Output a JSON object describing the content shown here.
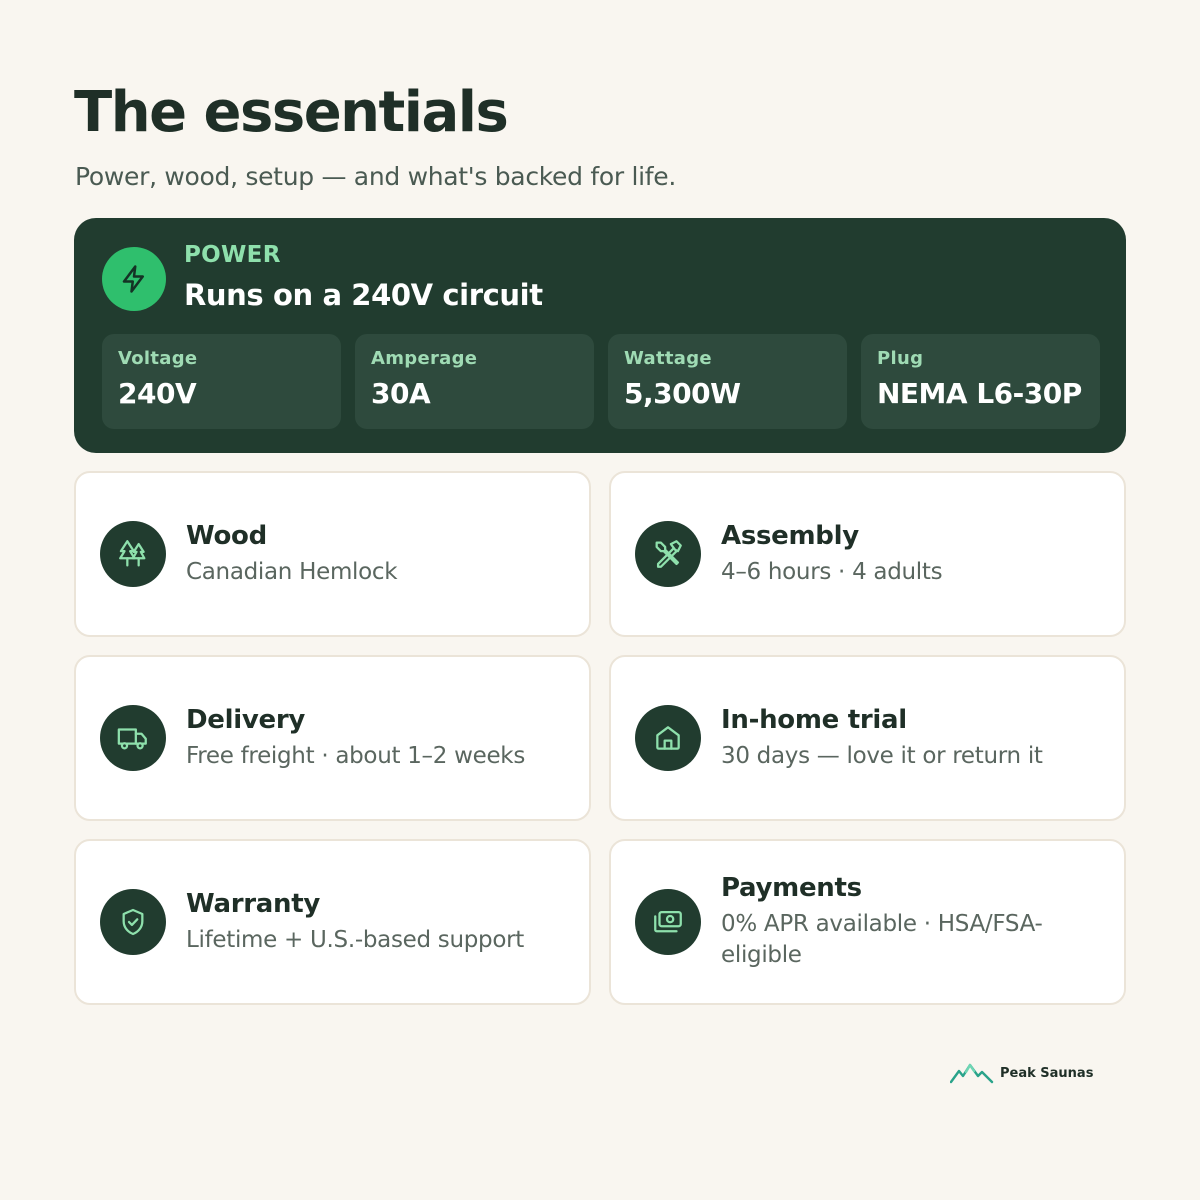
{
  "header": {
    "title": "The essentials",
    "subtitle": "Power, wood, setup — and what's backed for life."
  },
  "power": {
    "eyebrow": "POWER",
    "headline": "Runs on a 240V circuit",
    "icon": "lightning-bolt-icon",
    "specs": [
      {
        "label": "Voltage",
        "value": "240V"
      },
      {
        "label": "Amperage",
        "value": "30A"
      },
      {
        "label": "Wattage",
        "value": "5,300W"
      },
      {
        "label": "Plug",
        "value": "NEMA L6-30P"
      }
    ]
  },
  "features": [
    {
      "title": "Wood",
      "desc": "Canadian Hemlock",
      "icon": "tree-icon"
    },
    {
      "title": "Assembly",
      "desc": "4–6 hours · 4 adults",
      "icon": "tools-icon"
    },
    {
      "title": "Delivery",
      "desc": "Free freight · about 1–2 weeks",
      "icon": "truck-icon"
    },
    {
      "title": "In-home trial",
      "desc": "30 days — love it or return it",
      "icon": "home-icon"
    },
    {
      "title": "Warranty",
      "desc": "Lifetime + U.S.-based support",
      "icon": "shield-check-icon"
    },
    {
      "title": "Payments",
      "desc": "0% APR available · HSA/FSA-eligible",
      "icon": "cash-icon"
    }
  ],
  "brand": {
    "name": "Peak Saunas",
    "icon": "mountain-logo-icon"
  },
  "colors": {
    "background": "#f9f6f0",
    "dark_green": "#213c2f",
    "accent_green": "#2fbf6d",
    "mint": "#8ee0ac"
  }
}
